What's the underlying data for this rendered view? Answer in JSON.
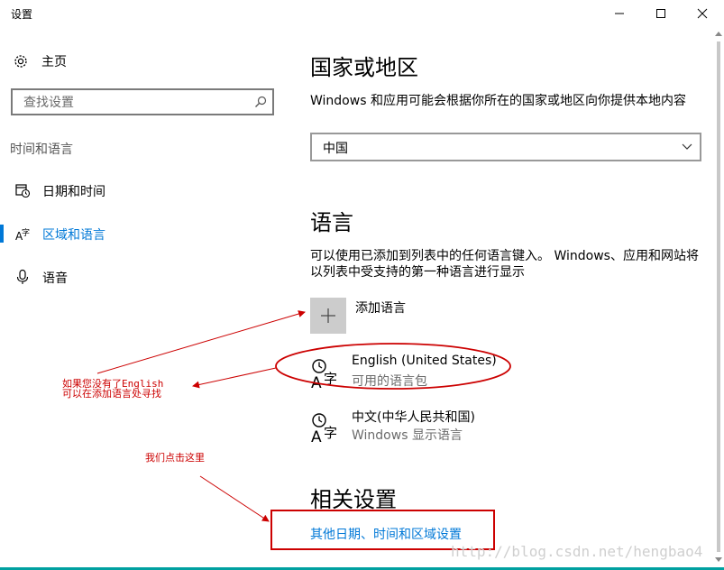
{
  "window": {
    "title": "设置",
    "minimize_icon": "minimize-icon",
    "maximize_icon": "maximize-icon",
    "close_icon": "close-icon"
  },
  "sidebar": {
    "home_label": "主页",
    "search_placeholder": "查找设置",
    "section_label": "时间和语言",
    "items": [
      {
        "label": "日期和时间",
        "icon": "calendar-clock-icon",
        "active": false
      },
      {
        "label": "区域和语言",
        "icon": "region-language-icon",
        "active": true
      },
      {
        "label": "语音",
        "icon": "microphone-icon",
        "active": false
      }
    ]
  },
  "main": {
    "region_heading": "国家或地区",
    "region_desc": "Windows 和应用可能会根据你所在的国家或地区向你提供本地内容",
    "country_value": "中国",
    "language_heading": "语言",
    "language_desc": "可以使用已添加到列表中的任何语言键入。 Windows、应用和网站将以列表中受支持的第一种语言进行显示",
    "add_language_label": "添加语言",
    "languages": [
      {
        "name": "English (United States)",
        "sub": "可用的语言包",
        "icon": "language-icon"
      },
      {
        "name": "中文(中华人民共和国)",
        "sub": "Windows 显示语言",
        "icon": "language-icon"
      }
    ],
    "related_heading": "相关设置",
    "related_link": "其他日期、时间和区域设置"
  },
  "annotations": {
    "note_english_line1": "如果您没有了English",
    "note_english_line2": "可以在添加语言处寻找",
    "note_click_here": "我们点击这里",
    "watermark": "http://blog.csdn.net/hengbao4"
  },
  "colors": {
    "accent": "#0078d7",
    "annotation": "#cc0000"
  }
}
